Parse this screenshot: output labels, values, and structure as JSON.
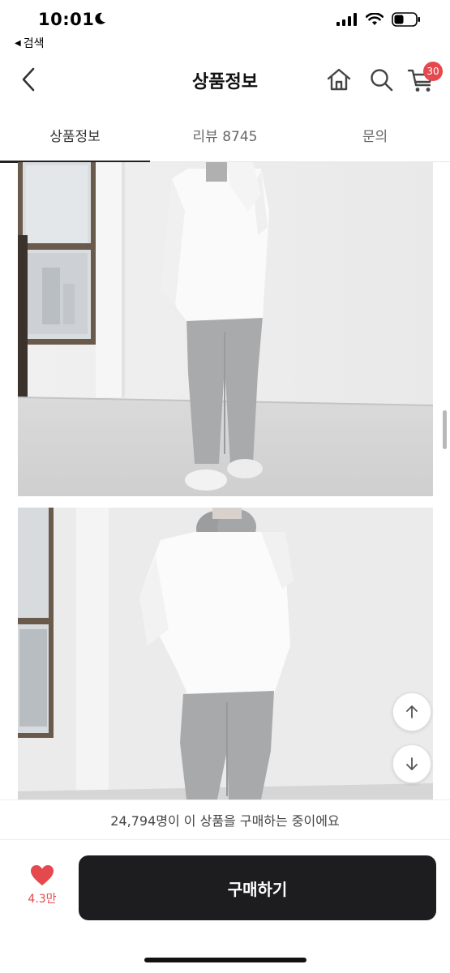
{
  "status_bar": {
    "time": "10:01",
    "back_app": "검색"
  },
  "header": {
    "title": "상품정보",
    "cart_count": "30"
  },
  "tabs": [
    {
      "label": "상품정보",
      "active": true
    },
    {
      "label": "리뷰 8745",
      "active": false
    },
    {
      "label": "문의",
      "active": false
    }
  ],
  "purchase": {
    "buyers_text": "24,794명이 이 상품을 구매하는 중이에요",
    "like_count": "4.3만",
    "buy_label": "구매하기"
  },
  "colors": {
    "accent": "#e5484d",
    "buy_button": "#1d1d1f"
  },
  "icons": [
    "moon-icon",
    "signal-icon",
    "wifi-icon",
    "battery-icon",
    "chevron-left-icon",
    "home-icon",
    "search-icon",
    "cart-icon",
    "heart-icon",
    "arrow-up-icon",
    "arrow-down-icon"
  ]
}
